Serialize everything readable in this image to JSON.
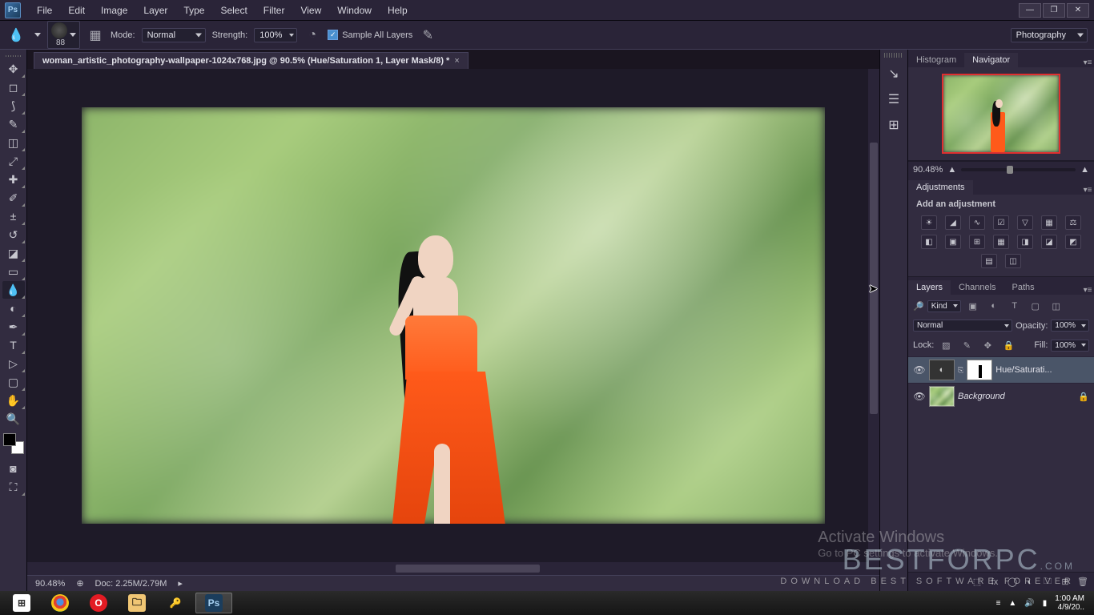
{
  "menu": [
    "File",
    "Edit",
    "Image",
    "Layer",
    "Type",
    "Select",
    "Filter",
    "View",
    "Window",
    "Help"
  ],
  "options": {
    "brush_size": "88",
    "mode_label": "Mode:",
    "mode_value": "Normal",
    "strength_label": "Strength:",
    "strength_value": "100%",
    "sample_all_label": "Sample All Layers",
    "workspace": "Photography"
  },
  "document": {
    "tab_title": "woman_artistic_photography-wallpaper-1024x768.jpg @ 90.5% (Hue/Saturation 1, Layer Mask/8) *",
    "status_zoom": "90.48%",
    "status_doc": "Doc: 2.25M/2.79M"
  },
  "navigator": {
    "tabs": [
      "Histogram",
      "Navigator"
    ],
    "zoom": "90.48%"
  },
  "adjustments": {
    "title": "Adjustments",
    "add_label": "Add an adjustment"
  },
  "layers": {
    "tabs": [
      "Layers",
      "Channels",
      "Paths"
    ],
    "filter_kind_label": "Kind",
    "blend_mode": "Normal",
    "opacity_label": "Opacity:",
    "opacity_value": "100%",
    "lock_label": "Lock:",
    "fill_label": "Fill:",
    "fill_value": "100%",
    "items": [
      {
        "name": "Hue/Saturati...",
        "type": "adjustment",
        "selected": true,
        "locked": false
      },
      {
        "name": "Background",
        "type": "image",
        "selected": false,
        "locked": true
      }
    ]
  },
  "watermarks": {
    "activate_h": "Activate Windows",
    "activate_sub": "Go to PC settings to activate Windows.",
    "brand": "BESTFORPC",
    "brand_sub": "DOWNLOAD BEST SOFTWARE FOREVER"
  },
  "taskbar": {
    "time": "1:00 AM",
    "date": "4/9/20.."
  }
}
